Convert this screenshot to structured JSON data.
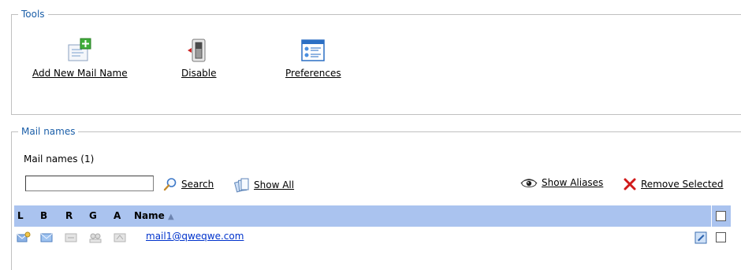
{
  "tools": {
    "legend": "Tools",
    "add_label": "Add New Mail Name",
    "disable_label": "Disable",
    "prefs_label": "Preferences"
  },
  "mail": {
    "legend": "Mail names",
    "count_text": "Mail names (1)",
    "search_value": "",
    "search_label": "Search",
    "show_all_label": "Show All",
    "show_aliases_label": "Show Aliases",
    "remove_label": "Remove Selected",
    "columns": {
      "L": "L",
      "B": "B",
      "R": "R",
      "G": "G",
      "A": "A",
      "name": "Name",
      "sort": "▲"
    },
    "rows": [
      {
        "name": "mail1@qweqwe.com"
      }
    ]
  },
  "colors": {
    "legend": "#1a5ea8",
    "header_bg": "#aac3ef",
    "link": "#0033cc"
  }
}
